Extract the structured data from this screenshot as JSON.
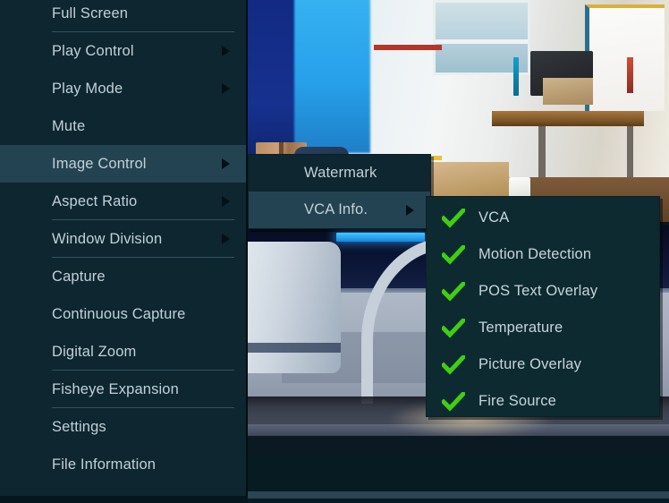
{
  "app": {
    "kind": "video-surveillance-client",
    "accent_check_color": "#3ecf12",
    "menu_background": "#0d2630",
    "menu_highlight": "#244352",
    "menu_text_color": "#c3d0d7",
    "separator_color": "#33525f"
  },
  "context_menu": {
    "name": "right-click-context-menu",
    "items": [
      {
        "label": "Full Screen",
        "has_submenu": false,
        "separator_after": true,
        "highlighted": false
      },
      {
        "label": "Play Control",
        "has_submenu": true,
        "separator_after": false,
        "highlighted": false
      },
      {
        "label": "Play Mode",
        "has_submenu": true,
        "separator_after": false,
        "highlighted": false
      },
      {
        "label": "Mute",
        "has_submenu": false,
        "separator_after": false,
        "highlighted": false
      },
      {
        "label": "Image Control",
        "has_submenu": true,
        "separator_after": false,
        "highlighted": true
      },
      {
        "label": "Aspect Ratio",
        "has_submenu": true,
        "separator_after": true,
        "highlighted": false
      },
      {
        "label": "Window Division",
        "has_submenu": true,
        "separator_after": true,
        "highlighted": false
      },
      {
        "label": "Capture",
        "has_submenu": false,
        "separator_after": false,
        "highlighted": false
      },
      {
        "label": "Continuous Capture",
        "has_submenu": false,
        "separator_after": false,
        "highlighted": false
      },
      {
        "label": "Digital Zoom",
        "has_submenu": false,
        "separator_after": true,
        "highlighted": false
      },
      {
        "label": "Fisheye Expansion",
        "has_submenu": false,
        "separator_after": true,
        "highlighted": false
      },
      {
        "label": "Settings",
        "has_submenu": false,
        "separator_after": false,
        "highlighted": false
      },
      {
        "label": "File Information",
        "has_submenu": false,
        "separator_after": false,
        "highlighted": false
      }
    ]
  },
  "image_control_submenu": {
    "name": "image-control-submenu",
    "items": [
      {
        "label": "Watermark",
        "has_submenu": false,
        "highlighted": false
      },
      {
        "label": "VCA Info.",
        "has_submenu": true,
        "highlighted": true
      }
    ]
  },
  "vca_info_submenu": {
    "name": "vca-info-submenu",
    "items": [
      {
        "label": "VCA",
        "checked": true
      },
      {
        "label": "Motion Detection",
        "checked": true
      },
      {
        "label": "POS Text Overlay",
        "checked": true
      },
      {
        "label": "Temperature",
        "checked": true
      },
      {
        "label": "Picture Overlay",
        "checked": true
      },
      {
        "label": "Fire Source",
        "checked": true
      }
    ]
  },
  "video_panes": [
    {
      "name": "live-view-pane-top",
      "description": "office interior with desks, cartons, whiteboard and bright window"
    },
    {
      "name": "live-view-pane-bottom",
      "description": "close-up of lab equipment with white canister and curved tube"
    }
  ]
}
